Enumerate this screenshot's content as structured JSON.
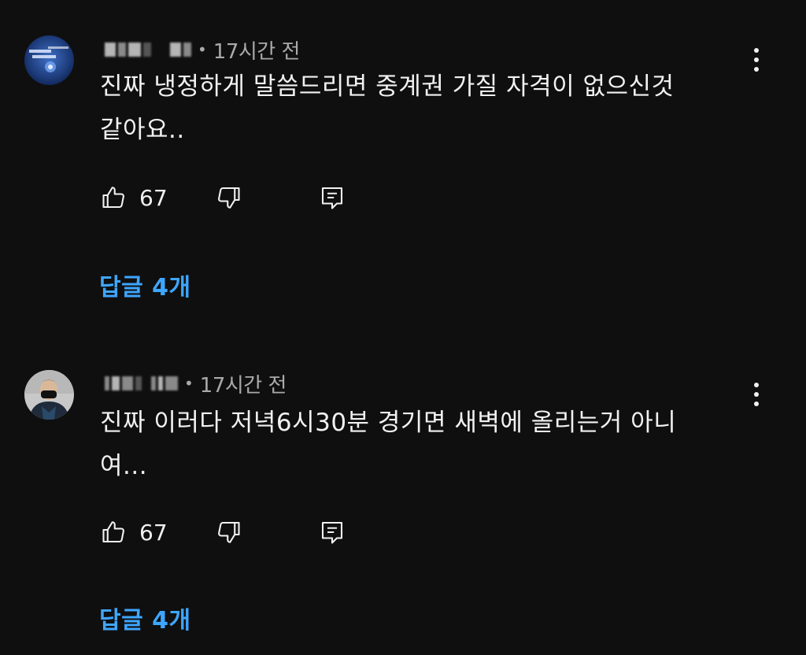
{
  "comments": [
    {
      "time": "17시간 전",
      "separator": "•",
      "text_line1": "진짜 냉정하게 말씀드리면 중계권 가질 자격이 없으신것",
      "text_line2": "같아요..",
      "like_count": "67",
      "replies_label": "답글 4개"
    },
    {
      "time": "17시간 전",
      "separator": "•",
      "text_line1": "진짜 이러다 저녁6시30분 경기면 새벽에 올리는거 아니",
      "text_line2": "여...",
      "like_count": "67",
      "replies_label": "답글 4개"
    }
  ],
  "icons": {
    "like": "thumbs-up-icon",
    "dislike": "thumbs-down-icon",
    "reply": "reply-comment-icon",
    "menu": "more-vertical-icon"
  },
  "colors": {
    "background": "#0f0f0f",
    "text": "#f1f1f1",
    "secondary_text": "#aaaaaa",
    "link": "#3ea6ff"
  }
}
